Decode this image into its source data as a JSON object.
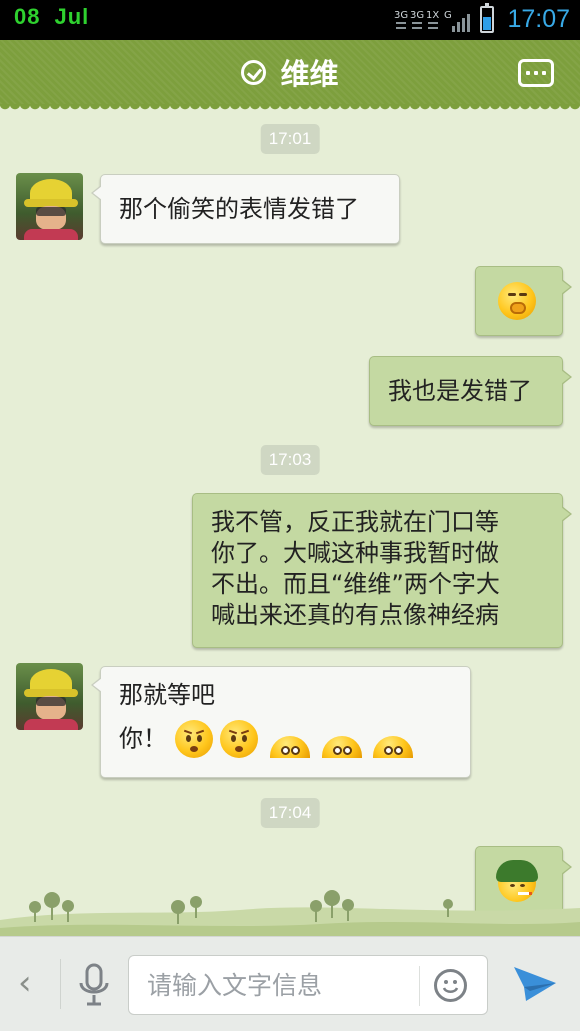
{
  "status_bar": {
    "day": "08",
    "month": "Jul",
    "network_label": "3G 3G 1X G",
    "time": "17:07",
    "battery_level": 0.55,
    "colors": {
      "date": "#2fd12f",
      "time": "#38a9e6"
    }
  },
  "header": {
    "title": "维维",
    "verified_icon": "check-circle-icon",
    "menu_icon": "more-dots-icon",
    "bg_color": "#7d9f3d"
  },
  "messages": [
    {
      "type": "timestamp",
      "text": "17:01"
    },
    {
      "type": "incoming",
      "text": "那个偷笑的表情发错了",
      "avatar": "contact-avatar"
    },
    {
      "type": "outgoing",
      "emoji": "snicker-emoji"
    },
    {
      "type": "outgoing",
      "text": "我也是发错了"
    },
    {
      "type": "timestamp",
      "text": "17:03"
    },
    {
      "type": "outgoing",
      "lines": [
        "我不管，反正我就在门口等",
        "你了。大喊这种事我暂时做",
        "不出。而且“维维”两个字大",
        "喊出来还真的有点像神经病"
      ]
    },
    {
      "type": "incoming",
      "line1": "那就等吧",
      "line2": "你！",
      "emojis": [
        "angry-emoji",
        "angry-emoji",
        "peek-emoji",
        "peek-emoji",
        "peek-emoji"
      ]
    },
    {
      "type": "timestamp",
      "text": "17:04"
    },
    {
      "type": "outgoing",
      "emoji": "soldier-emoji"
    }
  ],
  "input_bar": {
    "placeholder": "请输入文字信息",
    "value": "",
    "back_icon": "chevron-left-icon",
    "voice_icon": "microphone-icon",
    "emoji_icon": "smiley-icon",
    "send_icon": "send-icon"
  }
}
